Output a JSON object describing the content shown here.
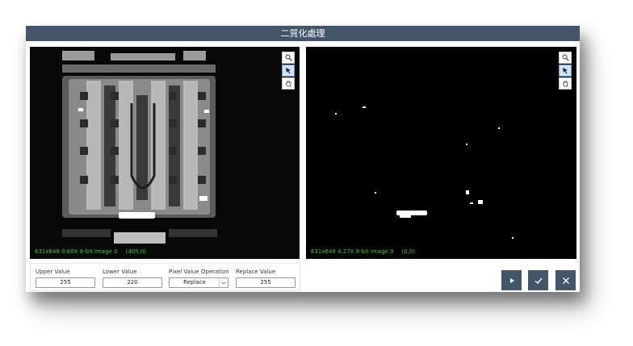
{
  "dialog": {
    "title": "二質化處理"
  },
  "left_viewer": {
    "status": "631x649 0.60X 8-bit image 0",
    "coord": "(405,0)",
    "tools": [
      "zoom-icon",
      "pointer-icon",
      "hand-icon"
    ]
  },
  "right_viewer": {
    "status": "631x649 4.27X 8-bit image 0",
    "coord": "(0,0)",
    "tools": [
      "zoom-icon",
      "pointer-icon",
      "hand-icon"
    ]
  },
  "params": {
    "upper_label": "Upper Value",
    "upper_value": "255",
    "lower_label": "Lower Value",
    "lower_value": "220",
    "operation_label": "Pixel Value Operation",
    "operation_value": "Replace",
    "replace_label": "Replace Value",
    "replace_value": "255"
  },
  "actions": [
    "play-icon",
    "check-icon",
    "close-icon"
  ],
  "colors": {
    "title_bar": "#43556b",
    "status_text": "#3fd12f",
    "button": "#43556b"
  }
}
